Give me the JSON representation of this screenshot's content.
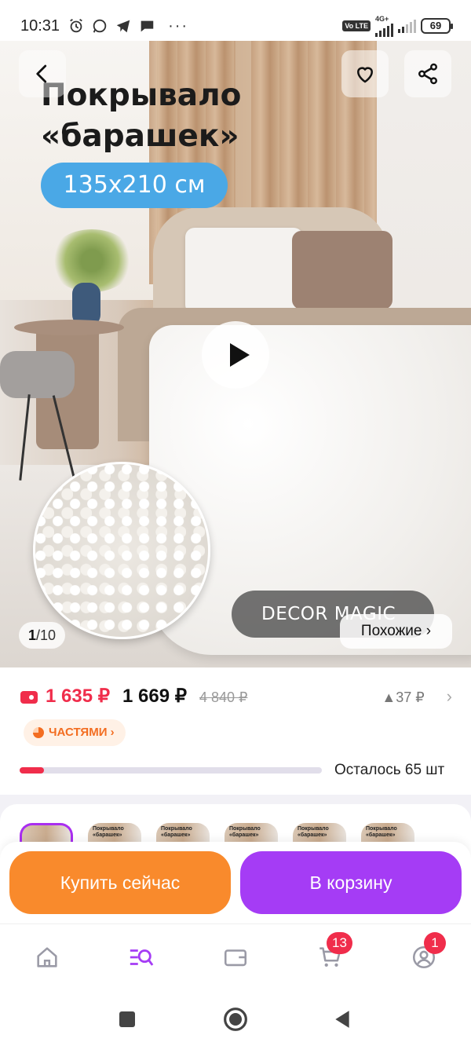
{
  "status_bar": {
    "time": "10:31",
    "net_label": "4G+",
    "volte": "Vo LTE",
    "battery": "69",
    "more": "···"
  },
  "hero": {
    "title_line1": "Покрывало",
    "title_line2": "«барашек»",
    "size_badge": "135x210 см",
    "brand": "DECOR MAGIC",
    "counter_current": "1",
    "counter_sep": "/",
    "counter_total": "10",
    "similar_label": "Похожие ›"
  },
  "price": {
    "card_price": "1 635 ₽",
    "regular_price": "1 669 ₽",
    "old_price": "4 840 ₽",
    "delta": "▲37 ₽",
    "parts_label": "ЧАСТЯМИ ›",
    "stock_text": "Осталось 65 шт",
    "stock_fraction": 0.08,
    "accent_color": "#f02d4b"
  },
  "thumbnails": [
    {
      "caption": ""
    },
    {
      "caption": "Покрывало «барашек»"
    },
    {
      "caption": "Покрывало «барашек»"
    },
    {
      "caption": "Покрывало «барашек»"
    },
    {
      "caption": "Покрывало «барашек»"
    },
    {
      "caption": "Покрывало «барашек»"
    }
  ],
  "actions": {
    "buy_now": "Купить сейчас",
    "add_to_cart": "В корзину",
    "buy_color": "#f98a2c",
    "cart_color": "#a53cf5"
  },
  "bottom_nav": {
    "items": [
      "home-icon",
      "catalog-search-icon",
      "wallet-icon",
      "cart-icon",
      "profile-icon"
    ],
    "cart_badge": "13",
    "profile_badge": "1",
    "active_color": "#a53cf5"
  }
}
